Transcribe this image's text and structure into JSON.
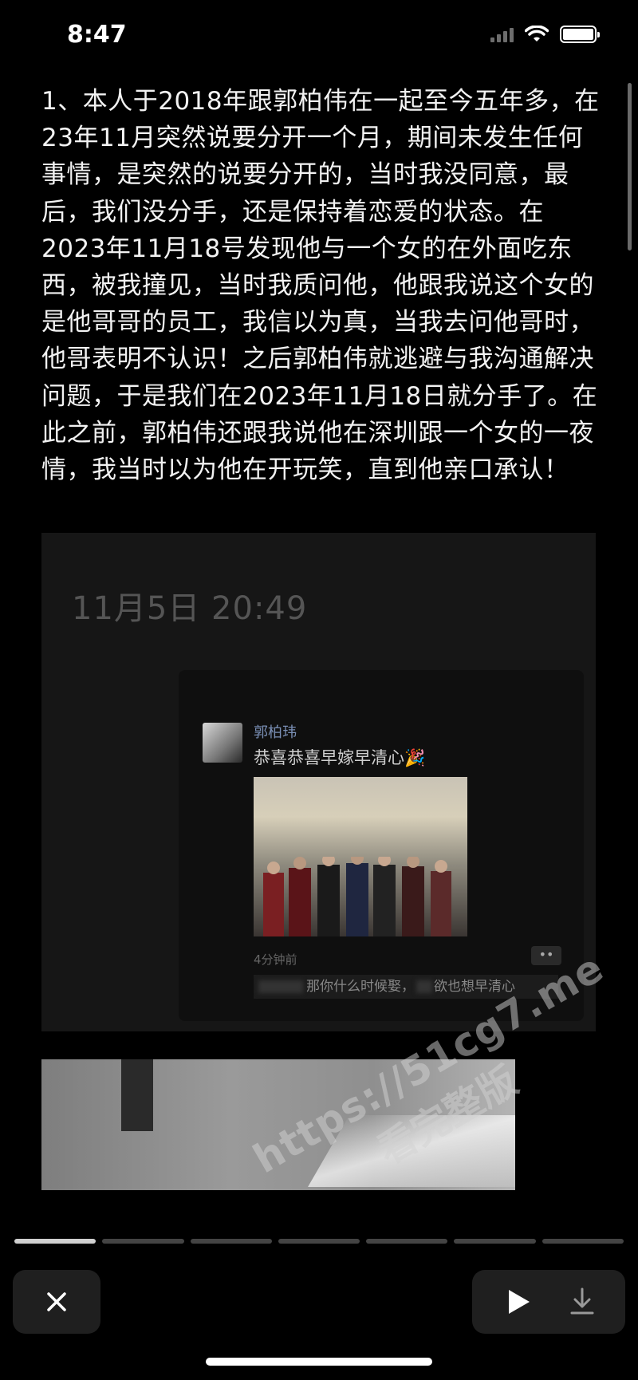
{
  "status_bar": {
    "time": "8:47"
  },
  "article": {
    "text": "1、本人于2018年跟郭柏伟在一起至今五年多，在23年11月突然说要分开一个月，期间未发生任何事情，是突然的说要分开的，当时我没同意，最后，我们没分手，还是保持着恋爱的状态。在2023年11月18号发现他与一个女的在外面吃东西，被我撞见，当时我质问他，他跟我说这个女的是他哥哥的员工，我信以为真，当我去问他哥时，他哥表明不认识！之后郭柏伟就逃避与我沟通解决问题，于是我们在2023年11月18日就分手了。在此之前，郭柏伟还跟我说他在深圳跟一个女的一夜情，我当时以为他在开玩笑，直到他亲口承认！"
  },
  "embed_screenshot": {
    "date": "11月5日 20:49",
    "moment": {
      "user": "郭柏玮",
      "caption": "恭喜恭喜早嫁早清心🎉",
      "time": "4分钟前",
      "more": "••",
      "comment_a": "那你什么时候娶，",
      "comment_b": "欲也想早清心"
    }
  },
  "progress": {
    "total": 7,
    "active_index": 0
  },
  "controls": {
    "close_icon": "close-icon",
    "play_icon": "play-icon",
    "download_icon": "download-icon"
  },
  "watermark": {
    "line1": "https://51cg7.me",
    "line2": "看完整版"
  }
}
